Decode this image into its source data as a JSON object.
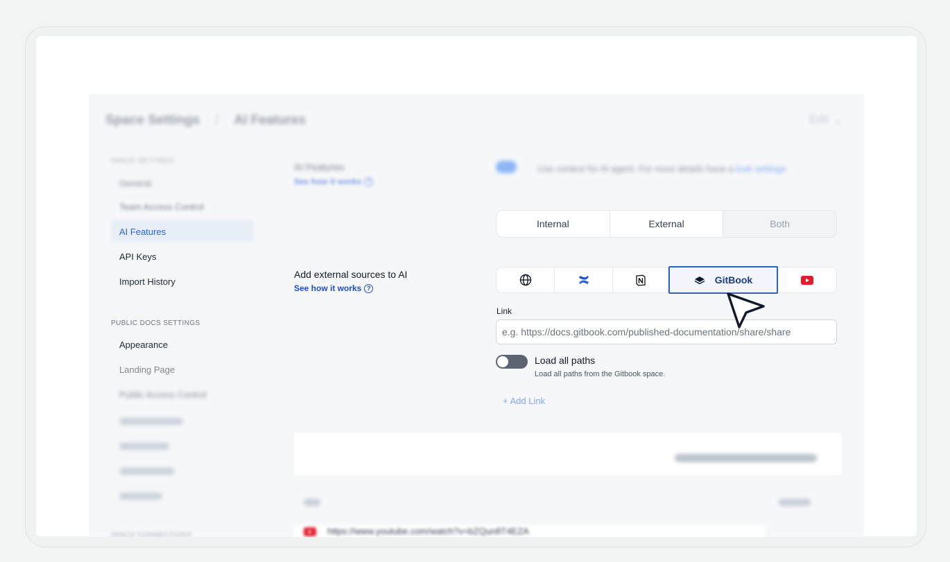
{
  "breadcrumb": {
    "parent": "Space Settings",
    "separator": "/",
    "current": "AI Features"
  },
  "header": {
    "right_label": "Edit"
  },
  "sidebar": {
    "section_space": "SPACE SETTINGS",
    "items_space": [
      {
        "label": "General"
      },
      {
        "label": "Team Access Control"
      },
      {
        "label": "AI Features",
        "active": true
      },
      {
        "label": "API Keys"
      },
      {
        "label": "Import History"
      }
    ],
    "section_public": "PUBLIC DOCS SETTINGS",
    "items_public": [
      {
        "label": "Appearance"
      },
      {
        "label": "Landing Page"
      },
      {
        "label": "Public Access Control"
      }
    ],
    "section_connections": "SPACE CONNECTIONS"
  },
  "ai_features": {
    "title": "AI Features",
    "see_how": "See how it works",
    "toggle_desc": "Use context for AI agent. For more details have a",
    "toggle_desc_link": "look settings"
  },
  "visibility_tabs": [
    "Internal",
    "External",
    "Both"
  ],
  "external_sources": {
    "title": "Add external sources to AI",
    "see_how": "See how it works",
    "sources": [
      {
        "icon": "globe-icon"
      },
      {
        "icon": "confluence-icon"
      },
      {
        "icon": "notion-icon"
      },
      {
        "icon": "gitbook-icon",
        "label": "GitBook",
        "selected": true
      },
      {
        "icon": "youtube-icon"
      }
    ],
    "link_label": "Link",
    "link_placeholder": "e.g. https://docs.gitbook.com/published-documentation/share/share",
    "load_all_title": "Load all paths",
    "load_all_desc": "Load all paths from the Gitbook space.",
    "load_all_enabled": false,
    "add_link": "+ Add Link"
  },
  "table": {
    "row_url": "https://www.youtube.com/watch?v=bZQun8T4EZA"
  },
  "colors": {
    "accent": "#2563eb",
    "selected_border": "#2b63b8",
    "youtube": "#e11d2b"
  }
}
